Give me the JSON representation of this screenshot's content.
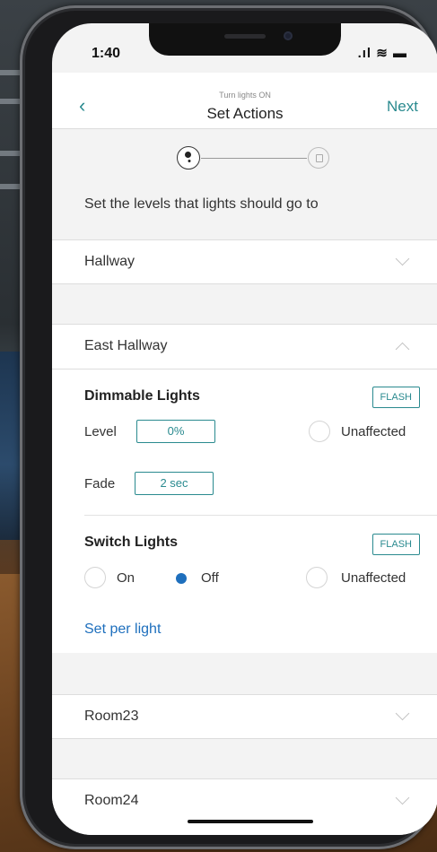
{
  "status": {
    "time": "1:40",
    "icons": ".ıl ≋ ▬"
  },
  "nav": {
    "back_icon": "‹",
    "subtitle": "Turn lights ON",
    "title": "Set Actions",
    "next_label": "Next"
  },
  "instructions": "Set the levels that lights should go to",
  "groups": [
    {
      "label": "Hallway",
      "expanded": false
    },
    {
      "label": "East Hallway",
      "expanded": true
    },
    {
      "label": "Room23",
      "expanded": false
    },
    {
      "label": "Room24",
      "expanded": false
    }
  ],
  "dimmable": {
    "title": "Dimmable Lights",
    "flash_label": "FLASH",
    "level_label": "Level",
    "level_value": "0%",
    "unaffected_label": "Unaffected",
    "fade_label": "Fade",
    "fade_value": "2 sec"
  },
  "switch": {
    "title": "Switch Lights",
    "flash_label": "FLASH",
    "on_label": "On",
    "off_label": "Off",
    "unaffected_label": "Unaffected",
    "selected": "Off"
  },
  "set_per_light": "Set per light",
  "colors": {
    "accent": "#2a8a8f",
    "link": "#1e6fbd",
    "background": "#f3f3f3"
  }
}
